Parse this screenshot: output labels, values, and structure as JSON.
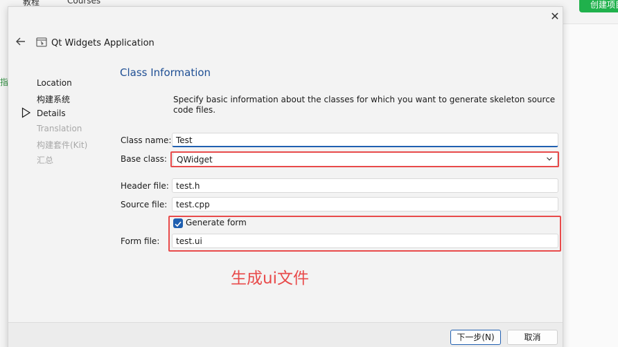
{
  "background": {
    "tabs": [
      "教程",
      "Courses"
    ],
    "create_button": "创建项目",
    "sidebar_fragment": "指南"
  },
  "dialog": {
    "title": "Qt Widgets Application",
    "close_glyph": "✕",
    "back_glyph": "←"
  },
  "steps": [
    {
      "label": "Location",
      "state": "done"
    },
    {
      "label": "构建系统",
      "state": "done"
    },
    {
      "label": "Details",
      "state": "current"
    },
    {
      "label": "Translation",
      "state": "pending"
    },
    {
      "label": "构建套件(Kit)",
      "state": "pending"
    },
    {
      "label": "汇总",
      "state": "pending"
    }
  ],
  "page": {
    "title": "Class Information",
    "description": "Specify basic information about the classes for which you want to generate skeleton source code files."
  },
  "form": {
    "class_name_label": "Class name:",
    "class_name_value": "Test",
    "base_class_label": "Base class:",
    "base_class_value": "QWidget",
    "header_file_label": "Header file:",
    "header_file_value": "test.h",
    "source_file_label": "Source file:",
    "source_file_value": "test.cpp",
    "generate_form_label": "Generate form",
    "generate_form_checked": true,
    "form_file_label": "Form file:",
    "form_file_value": "test.ui"
  },
  "annotation": "生成ui文件",
  "buttons": {
    "next": "下一步(N)",
    "cancel": "取消"
  },
  "colors": {
    "title_blue": "#1f4f94",
    "highlight_red": "#e84a4a",
    "accent_blue": "#1f5fb0",
    "create_green": "#20b14c"
  }
}
